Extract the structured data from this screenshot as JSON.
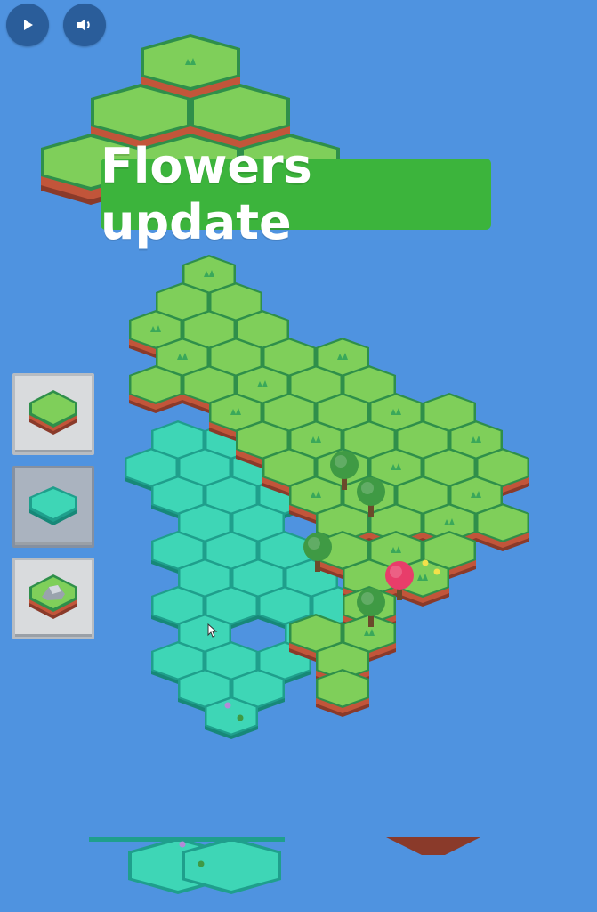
{
  "banner": {
    "text": "Flowers update"
  },
  "controls": {
    "play": {
      "icon": "play-icon"
    },
    "volume": {
      "icon": "volume-icon"
    }
  },
  "palette": {
    "tiles": [
      {
        "id": "grass",
        "icon": "grass-tile-icon",
        "selected": false
      },
      {
        "id": "water",
        "icon": "water-tile-icon",
        "selected": true
      },
      {
        "id": "rock",
        "icon": "rock-tile-icon",
        "selected": false
      }
    ]
  },
  "colors": {
    "background": "#4f93e0",
    "grass": "#7fcf5a",
    "grass_edge": "#2f8f4a",
    "water": "#3ed6b6",
    "water_edge": "#1f9f8c",
    "dirt": "#c2553a",
    "banner": "#3cb43c",
    "blossom_tree": "#e83d6a"
  }
}
